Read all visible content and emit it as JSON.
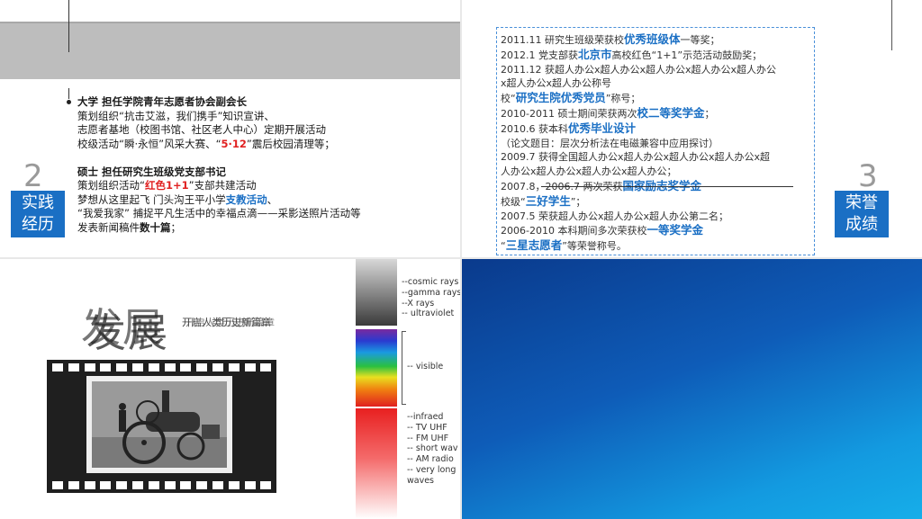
{
  "q1": {
    "section_number": "2",
    "section_tag": [
      "实践",
      "经历"
    ],
    "lines": [
      {
        "parts": [
          {
            "t": "大学       担任学院青年志愿者协会副会长",
            "s": "b"
          }
        ]
      },
      {
        "parts": [
          {
            "t": "策划组织“抗击艾滋，我们携手”知识宣讲、",
            "s": ""
          }
        ]
      },
      {
        "parts": [
          {
            "t": "志愿者基地（校图书馆、社区老人中心）定期开展活动",
            "s": ""
          }
        ]
      },
      {
        "parts": [
          {
            "t": "校级活动“瞬·永恒”风采大赛、“",
            "s": ""
          },
          {
            "t": "5·12",
            "s": "red"
          },
          {
            "t": "”震后校园清理等；",
            "s": ""
          }
        ]
      },
      {
        "parts": [
          {
            "t": "",
            "s": ""
          }
        ]
      },
      {
        "parts": [
          {
            "t": "硕士       担任研究生班级党支部书记",
            "s": "b"
          }
        ]
      },
      {
        "parts": [
          {
            "t": "策划组织活动“",
            "s": ""
          },
          {
            "t": "红色1+1",
            "s": "red"
          },
          {
            "t": "”支部共建活动",
            "s": ""
          }
        ]
      },
      {
        "parts": [
          {
            "t": "梦想从这里起飞   门头沟王平小学",
            "s": ""
          },
          {
            "t": "支教活动",
            "s": "blue"
          },
          {
            "t": "、",
            "s": ""
          }
        ]
      },
      {
        "parts": [
          {
            "t": "“我爱我家” 捕捉平凡生活中的幸福点滴——采影送照片活动等",
            "s": ""
          }
        ]
      },
      {
        "parts": [
          {
            "t": "发表新闻稿件",
            "s": ""
          },
          {
            "t": "数十篇",
            "s": "b"
          },
          {
            "t": "；",
            "s": ""
          }
        ]
      }
    ]
  },
  "q2": {
    "section_number": "3",
    "section_tag": [
      "荣誉",
      "成绩"
    ],
    "lines": [
      {
        "parts": [
          {
            "t": "2011.11 研究生班级荣获校",
            "s": ""
          },
          {
            "t": "优秀班级体",
            "s": "blue"
          },
          {
            "t": "一等奖；",
            "s": ""
          }
        ]
      },
      {
        "parts": [
          {
            "t": "2012.1  党支部获",
            "s": ""
          },
          {
            "t": "北京市",
            "s": "blue"
          },
          {
            "t": "高校红色“1+1”示范活动鼓励奖；",
            "s": ""
          }
        ]
      },
      {
        "parts": [
          {
            "t": "2011.12 获超人办公x超人办公x超人办公x超人办公x超人办公",
            "s": ""
          }
        ]
      },
      {
        "parts": [
          {
            "t": "x超人办公x超人办公称号",
            "s": ""
          }
        ]
      },
      {
        "parts": [
          {
            "t": "            校“",
            "s": ""
          },
          {
            "t": "研究生院优秀党员",
            "s": "blue"
          },
          {
            "t": "”称号；",
            "s": ""
          }
        ]
      },
      {
        "parts": [
          {
            "t": "2010-2011 硕士期间荣获两次",
            "s": ""
          },
          {
            "t": "校二等奖学金",
            "s": "blue"
          },
          {
            "t": "；",
            "s": ""
          }
        ]
      },
      {
        "parts": [
          {
            "t": "2010.6   获本科",
            "s": ""
          },
          {
            "t": "优秀毕业设计",
            "s": "blue"
          }
        ]
      },
      {
        "parts": [
          {
            "t": "（论文题目：层次分析法在电磁兼容中应用探讨）",
            "s": ""
          }
        ]
      },
      {
        "parts": [
          {
            "t": "2009.7 获得全国超人办公x超人办公x超人办公x超人办公x超",
            "s": ""
          }
        ]
      },
      {
        "parts": [
          {
            "t": "人办公x超人办公x超人办公x超人办公；",
            "s": ""
          }
        ]
      },
      {
        "parts": [
          {
            "t": "2007.8，2006.7 两次荣获",
            "s": ""
          },
          {
            "t": "国家励志奖学金",
            "s": "blue"
          }
        ]
      },
      {
        "parts": [
          {
            "t": "           校级“",
            "s": ""
          },
          {
            "t": "三好学生",
            "s": "blue"
          },
          {
            "t": "”；",
            "s": ""
          }
        ]
      },
      {
        "parts": [
          {
            "t": "2007.5 荣获超人办公x超人办公x超人办公第二名；",
            "s": ""
          }
        ]
      },
      {
        "parts": [
          {
            "t": "2006-2010 本科期间多次荣获校",
            "s": ""
          },
          {
            "t": "一等奖学金",
            "s": "blue"
          }
        ]
      },
      {
        "parts": [
          {
            "t": "          “",
            "s": ""
          },
          {
            "t": "三星志愿者",
            "s": "blue"
          },
          {
            "t": "”等荣誉称号。",
            "s": ""
          }
        ]
      }
    ]
  },
  "q3": {
    "title_back": "发展",
    "title_front": "发展",
    "subtitle_back": "开启人类历史新篇章",
    "subtitle_front": "开启人类历史新篇章",
    "spectrum_top": [
      "--cosmic rays",
      "--gamma rays",
      "--X rays",
      "-- ultraviolet"
    ],
    "spectrum_visible": "-- visible",
    "spectrum_bottom": [
      "--infraed",
      "-- TV UHF",
      "-- FM UHF",
      "-- short wav",
      "-- AM radio",
      "-- very long",
      "   waves"
    ]
  },
  "colors": {
    "accent_blue": "#1a6fc4",
    "red": "#e02020",
    "blue_bg": "#0e5cb8"
  }
}
